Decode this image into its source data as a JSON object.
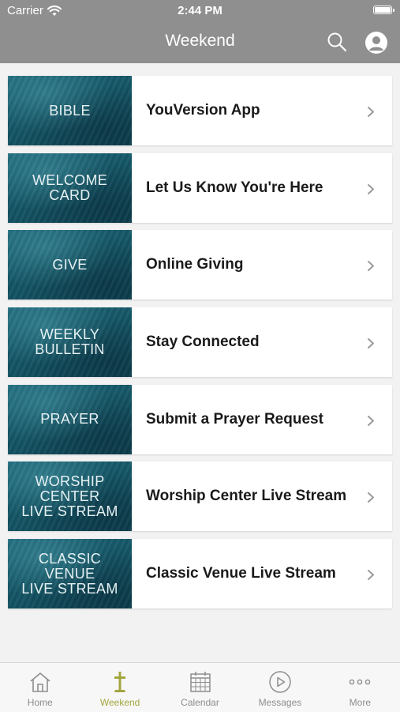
{
  "status_bar": {
    "carrier": "Carrier",
    "time": "2:44 PM"
  },
  "header": {
    "title": "Weekend"
  },
  "items": [
    {
      "thumb": "BIBLE",
      "label": "YouVersion App"
    },
    {
      "thumb": "WELCOME\nCARD",
      "label": "Let Us Know You're Here"
    },
    {
      "thumb": "GIVE",
      "label": "Online Giving"
    },
    {
      "thumb": "WEEKLY\nBULLETIN",
      "label": "Stay Connected"
    },
    {
      "thumb": "PRAYER",
      "label": "Submit a Prayer Request"
    },
    {
      "thumb": "WORSHIP\nCENTER\nLIVE STREAM",
      "label": "Worship Center Live Stream"
    },
    {
      "thumb": "CLASSIC\nVENUE\nLIVE STREAM",
      "label": "Classic Venue Live Stream"
    }
  ],
  "tabs": [
    {
      "label": "Home",
      "icon": "home-icon"
    },
    {
      "label": "Weekend",
      "icon": "cross-icon"
    },
    {
      "label": "Calendar",
      "icon": "calendar-icon"
    },
    {
      "label": "Messages",
      "icon": "play-icon"
    },
    {
      "label": "More",
      "icon": "more-icon"
    }
  ],
  "active_tab": "Weekend",
  "colors": {
    "header_bg": "#8f8f8f",
    "accent": "#a3a63e",
    "thumb_teal": "#155767",
    "background": "#f2f2f2"
  }
}
